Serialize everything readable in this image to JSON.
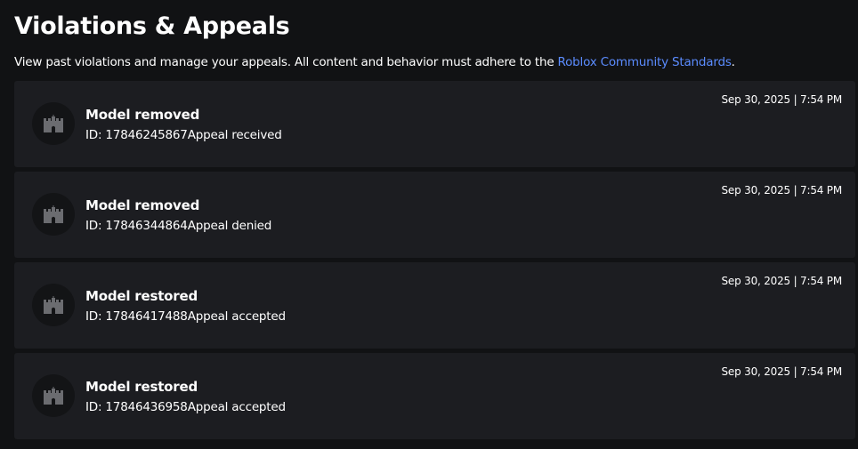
{
  "header": {
    "title": "Violations & Appeals",
    "description_prefix": "View past violations and manage your appeals. All content and behavior must adhere to the ",
    "community_link": "Roblox Community Standards",
    "description_suffix": "."
  },
  "violations": [
    {
      "icon": "castle-icon",
      "title": "Model removed",
      "id_label": "ID: 17846245867",
      "appeal_status": "Appeal received",
      "date": "Sep 30, 2025 | 7:54 PM"
    },
    {
      "icon": "castle-icon",
      "title": "Model removed",
      "id_label": "ID: 17846344864",
      "appeal_status": "Appeal denied",
      "date": "Sep 30, 2025 | 7:54 PM"
    },
    {
      "icon": "castle-icon",
      "title": "Model restored",
      "id_label": "ID: 17846417488",
      "appeal_status": "Appeal accepted",
      "date": "Sep 30, 2025 | 7:54 PM"
    },
    {
      "icon": "castle-icon",
      "title": "Model restored",
      "id_label": "ID: 17846436958",
      "appeal_status": "Appeal accepted",
      "date": "Sep 30, 2025 | 7:54 PM"
    }
  ],
  "colors": {
    "background": "#111214",
    "card": "#1c1d21",
    "link": "#5b8cff",
    "icon": "#6b6c70"
  }
}
